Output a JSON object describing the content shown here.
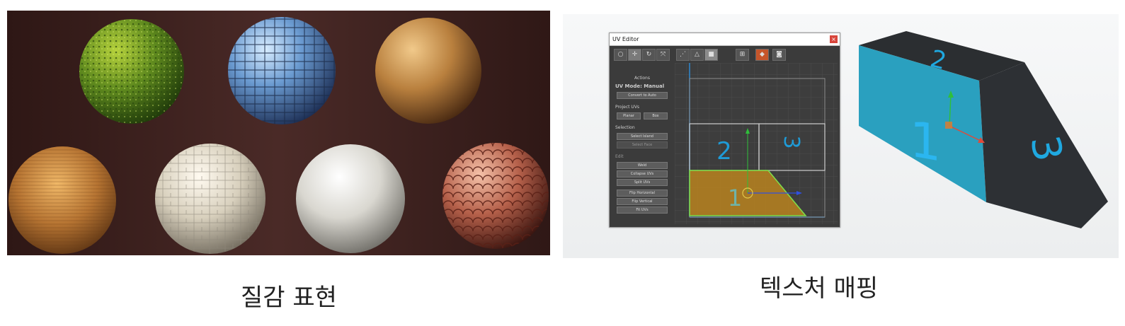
{
  "captions": {
    "left": "질감 표현",
    "right": "텍스처 매핑"
  },
  "uv_editor": {
    "title": "UV Editor",
    "close": "×",
    "sidebar": {
      "actions_header": "Actions",
      "uv_mode": "UV Mode: Manual",
      "convert_to_auto": "Convert to Auto",
      "project_uvs": "Project UVs",
      "planar": "Planar",
      "box": "Box",
      "selection": "Selection",
      "select_island": "Select Island",
      "select_face": "Select Face",
      "edit": "Edit",
      "weld": "Weld",
      "collapse_uvs": "Collapse UVs",
      "split_uvs": "Split UVs",
      "flip_horizontal": "Flip Horizontal",
      "flip_vertical": "Flip Vertical",
      "fit_uvs": "Fit UVs"
    },
    "uv_labels": [
      "2",
      "3",
      "1"
    ]
  },
  "box_labels": [
    "2",
    "1",
    "3"
  ],
  "colors": {
    "wall": "#3b1e1c",
    "uv_blue": "#1f9bd7",
    "face_teal": "#2aa0bf",
    "face_dark": "#2b2e31",
    "uv_fill": "#b8831f",
    "uv_edge": "#7fe04a"
  }
}
